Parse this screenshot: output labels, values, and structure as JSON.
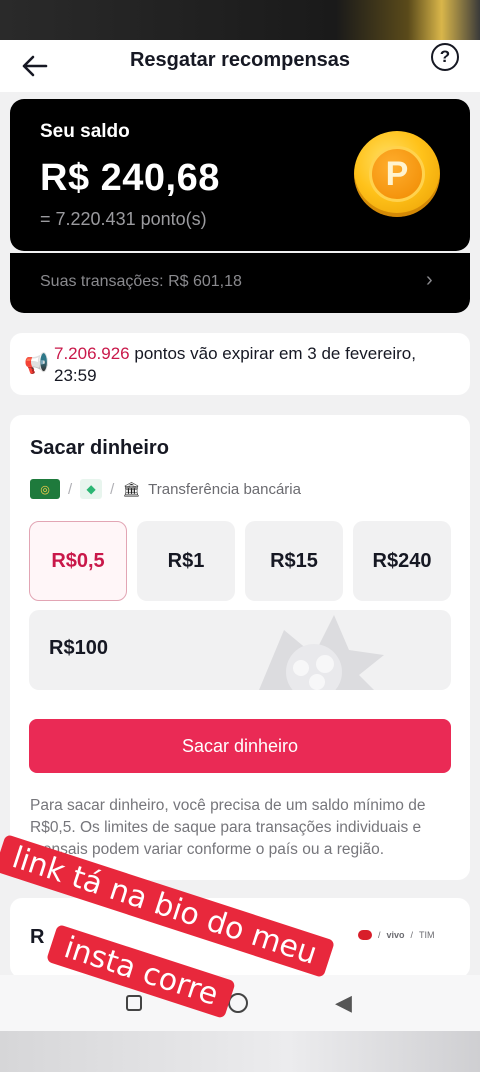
{
  "header": {
    "title": "Resgatar recompensas",
    "help_glyph": "?"
  },
  "balance": {
    "label": "Seu saldo",
    "amount": "R$ 240,68",
    "points": "= 7.220.431 ponto(s)",
    "coin_letter": "P"
  },
  "transactions": {
    "label": "Suas transações: R$ 601,18",
    "chevron": "›"
  },
  "notice": {
    "icon": "📢",
    "points": "7.206.926",
    "text": " pontos vão expirar em 3 de fevereiro, 23:59"
  },
  "withdraw": {
    "title": "Sacar dinheiro",
    "methods": {
      "pix_label": "◎",
      "diamond_label": "◆",
      "separator": "/",
      "bank_icon": "🏛",
      "bank_label": "Transferência bancária"
    },
    "amounts": [
      {
        "label": "R$0,5",
        "selected": true
      },
      {
        "label": "R$1",
        "selected": false
      },
      {
        "label": "R$15",
        "selected": false
      },
      {
        "label": "R$240",
        "selected": false
      }
    ],
    "wide_amount": "R$100",
    "cta_label": "Sacar dinheiro",
    "terms": "Para sacar dinheiro, você precisa de um saldo mínimo de R$0,5. Os limites de saque para transações individuais e mensais podem variar conforme o país ou a região."
  },
  "recharge": {
    "title_fragment": "R",
    "carriers": [
      "vivo",
      "TIM"
    ],
    "separator": "/"
  },
  "overlay": {
    "line1": "link tá na bio do meu",
    "line2": "insta corre"
  },
  "colors": {
    "accent": "#ea2a55",
    "selected_text": "#c9184a",
    "overlay": "#e8283c",
    "card_dark": "#000000"
  }
}
